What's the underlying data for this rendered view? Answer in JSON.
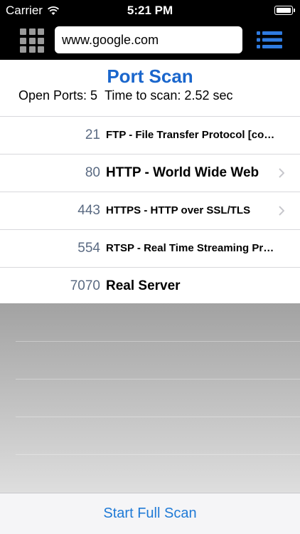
{
  "status_bar": {
    "carrier": "Carrier",
    "time": "5:21 PM"
  },
  "nav": {
    "url_value": "www.google.com"
  },
  "page": {
    "title": "Port Scan",
    "open_ports_label": "Open Ports: 5",
    "scan_time_label": "Time to scan: 2.52 sec"
  },
  "ports": [
    {
      "port": "21",
      "desc": "FTP - File Transfer Protocol [control]",
      "chevron": false
    },
    {
      "port": "80",
      "desc": "HTTP - World Wide Web",
      "chevron": true
    },
    {
      "port": "443",
      "desc": "HTTPS - HTTP over SSL/TLS",
      "chevron": true
    },
    {
      "port": "554",
      "desc": "RTSP - Real Time Streaming Protocol",
      "chevron": false
    },
    {
      "port": "7070",
      "desc": "Real Server",
      "chevron": false
    }
  ],
  "footer": {
    "scan_button": "Start Full Scan"
  },
  "colors": {
    "title": "#1a66cc",
    "button_text": "#1f7ad6",
    "port_number": "#5a6a82",
    "list_icon": "#2f7be0"
  },
  "icons": {
    "menu": "grid-menu-icon",
    "list": "list-icon",
    "wifi": "wifi-icon",
    "battery": "battery-icon",
    "chevron": "chevron-right-icon"
  }
}
